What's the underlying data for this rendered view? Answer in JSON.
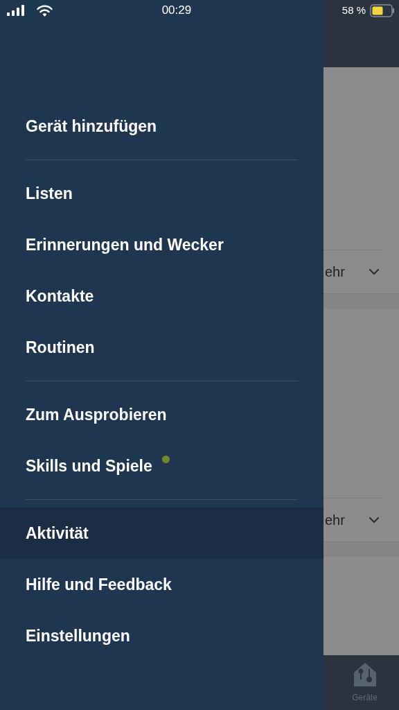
{
  "status_bar": {
    "time": "00:29",
    "battery_text": "58 %"
  },
  "menu": {
    "groups": [
      [
        {
          "label": "Gerät hinzufügen",
          "selected": false
        }
      ],
      [
        {
          "label": "Listen",
          "selected": false
        },
        {
          "label": "Erinnerungen und Wecker",
          "selected": false
        },
        {
          "label": "Kontakte",
          "selected": false
        },
        {
          "label": "Routinen",
          "selected": false
        }
      ],
      [
        {
          "label": "Zum Ausprobieren",
          "selected": false
        },
        {
          "label": "Skills und Spiele",
          "selected": false,
          "color": "#6b8a2a"
        }
      ],
      [
        {
          "label": "Aktivität",
          "selected": true
        },
        {
          "label": "Hilfe und Feedback",
          "selected": false
        },
        {
          "label": "Einstellungen",
          "selected": false
        }
      ]
    ]
  },
  "background": {
    "more_buttons": [
      "ehr",
      "ehr"
    ],
    "tab": "Geräte"
  }
}
